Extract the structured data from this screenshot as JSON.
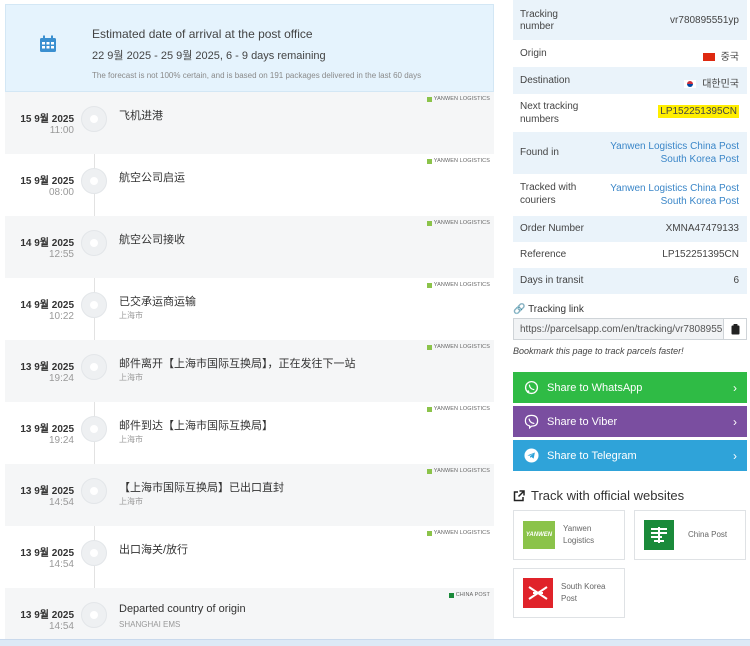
{
  "eta": {
    "title": "Estimated date of arrival at the post office",
    "range": "22 9월 2025 - 25 9월 2025, 6 - 9 days remaining",
    "note": "The forecast is not 100% certain, and is based on 191 packages delivered in the last 60 days"
  },
  "events": [
    {
      "date": "15 9월 2025",
      "time": "11:00",
      "desc": "飞机进港",
      "loc": "",
      "courier": "YANWEN LOGISTICS"
    },
    {
      "date": "15 9월 2025",
      "time": "08:00",
      "desc": "航空公司启运",
      "loc": "",
      "courier": "YANWEN LOGISTICS"
    },
    {
      "date": "14 9월 2025",
      "time": "12:55",
      "desc": "航空公司接收",
      "loc": "",
      "courier": "YANWEN LOGISTICS"
    },
    {
      "date": "14 9월 2025",
      "time": "10:22",
      "desc": "已交承运商运输",
      "loc": "上海市",
      "courier": "YANWEN LOGISTICS"
    },
    {
      "date": "13 9월 2025",
      "time": "19:24",
      "desc": "邮件离开【上海市国际互换局】，正在发往下一站",
      "loc": "上海市",
      "courier": "YANWEN LOGISTICS"
    },
    {
      "date": "13 9월 2025",
      "time": "19:24",
      "desc": "邮件到达【上海市国际互换局】",
      "loc": "上海市",
      "courier": "YANWEN LOGISTICS"
    },
    {
      "date": "13 9월 2025",
      "time": "14:54",
      "desc": "【上海市国际互换局】已出口直封",
      "loc": "上海市",
      "courier": "YANWEN LOGISTICS"
    },
    {
      "date": "13 9월 2025",
      "time": "14:54",
      "desc": "出口海关/放行",
      "loc": "",
      "courier": "YANWEN LOGISTICS"
    },
    {
      "date": "13 9월 2025",
      "time": "14:54",
      "desc": "Departed country of origin",
      "loc": "SHANGHAI EMS",
      "courier": "CHINA POST"
    }
  ],
  "info": {
    "tracking_number_label": "Tracking number",
    "tracking_number": "vr780895551yp",
    "origin_label": "Origin",
    "origin": "중국",
    "destination_label": "Destination",
    "destination": "대한민국",
    "next_tracking_label": "Next tracking numbers",
    "next_tracking": "LP152251395CN",
    "found_in_label": "Found in",
    "found_in_line1": "Yanwen Logistics  China Post",
    "found_in_line2": "South Korea Post",
    "tracked_with_label": "Tracked with couriers",
    "tracked_with_line1": "Yanwen Logistics  China Post",
    "tracked_with_line2": "South Korea Post",
    "order_number_label": "Order Number",
    "order_number": "XMNA47479133",
    "reference_label": "Reference",
    "reference": "LP152251395CN",
    "days_label": "Days in transit",
    "days": "6"
  },
  "tracking_link": {
    "label": "Tracking link",
    "url": "https://parcelsapp.com/en/tracking/vr7808955",
    "bookmark": "Bookmark this page to track parcels faster!"
  },
  "share": {
    "whatsapp": "Share to WhatsApp",
    "viber": "Share to Viber",
    "telegram": "Share to Telegram"
  },
  "official": {
    "title": "Track with official websites",
    "yanwen": "Yanwen Logistics",
    "china_post": "China Post",
    "korea_post": "South Korea Post"
  },
  "colors": {
    "whatsapp": "#2fbb45",
    "viber": "#7a4ea0",
    "telegram": "#2fa3d9",
    "yanwen_square": "#8bc34a",
    "china_post_square": "#1a8a3a"
  }
}
